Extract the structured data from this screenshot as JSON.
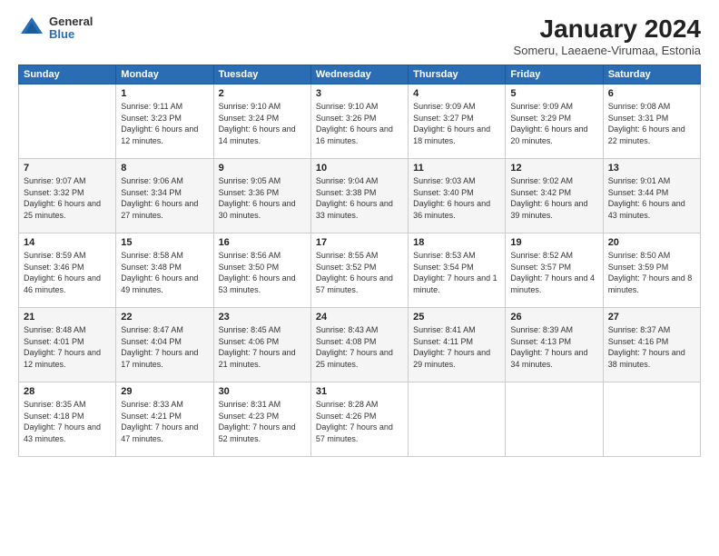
{
  "logo": {
    "general": "General",
    "blue": "Blue"
  },
  "header": {
    "title": "January 2024",
    "subtitle": "Someru, Laeaene-Virumaa, Estonia"
  },
  "weekdays": [
    "Sunday",
    "Monday",
    "Tuesday",
    "Wednesday",
    "Thursday",
    "Friday",
    "Saturday"
  ],
  "weeks": [
    [
      {
        "day": "",
        "sunrise": "",
        "sunset": "",
        "daylight": ""
      },
      {
        "day": "1",
        "sunrise": "Sunrise: 9:11 AM",
        "sunset": "Sunset: 3:23 PM",
        "daylight": "Daylight: 6 hours and 12 minutes."
      },
      {
        "day": "2",
        "sunrise": "Sunrise: 9:10 AM",
        "sunset": "Sunset: 3:24 PM",
        "daylight": "Daylight: 6 hours and 14 minutes."
      },
      {
        "day": "3",
        "sunrise": "Sunrise: 9:10 AM",
        "sunset": "Sunset: 3:26 PM",
        "daylight": "Daylight: 6 hours and 16 minutes."
      },
      {
        "day": "4",
        "sunrise": "Sunrise: 9:09 AM",
        "sunset": "Sunset: 3:27 PM",
        "daylight": "Daylight: 6 hours and 18 minutes."
      },
      {
        "day": "5",
        "sunrise": "Sunrise: 9:09 AM",
        "sunset": "Sunset: 3:29 PM",
        "daylight": "Daylight: 6 hours and 20 minutes."
      },
      {
        "day": "6",
        "sunrise": "Sunrise: 9:08 AM",
        "sunset": "Sunset: 3:31 PM",
        "daylight": "Daylight: 6 hours and 22 minutes."
      }
    ],
    [
      {
        "day": "7",
        "sunrise": "Sunrise: 9:07 AM",
        "sunset": "Sunset: 3:32 PM",
        "daylight": "Daylight: 6 hours and 25 minutes."
      },
      {
        "day": "8",
        "sunrise": "Sunrise: 9:06 AM",
        "sunset": "Sunset: 3:34 PM",
        "daylight": "Daylight: 6 hours and 27 minutes."
      },
      {
        "day": "9",
        "sunrise": "Sunrise: 9:05 AM",
        "sunset": "Sunset: 3:36 PM",
        "daylight": "Daylight: 6 hours and 30 minutes."
      },
      {
        "day": "10",
        "sunrise": "Sunrise: 9:04 AM",
        "sunset": "Sunset: 3:38 PM",
        "daylight": "Daylight: 6 hours and 33 minutes."
      },
      {
        "day": "11",
        "sunrise": "Sunrise: 9:03 AM",
        "sunset": "Sunset: 3:40 PM",
        "daylight": "Daylight: 6 hours and 36 minutes."
      },
      {
        "day": "12",
        "sunrise": "Sunrise: 9:02 AM",
        "sunset": "Sunset: 3:42 PM",
        "daylight": "Daylight: 6 hours and 39 minutes."
      },
      {
        "day": "13",
        "sunrise": "Sunrise: 9:01 AM",
        "sunset": "Sunset: 3:44 PM",
        "daylight": "Daylight: 6 hours and 43 minutes."
      }
    ],
    [
      {
        "day": "14",
        "sunrise": "Sunrise: 8:59 AM",
        "sunset": "Sunset: 3:46 PM",
        "daylight": "Daylight: 6 hours and 46 minutes."
      },
      {
        "day": "15",
        "sunrise": "Sunrise: 8:58 AM",
        "sunset": "Sunset: 3:48 PM",
        "daylight": "Daylight: 6 hours and 49 minutes."
      },
      {
        "day": "16",
        "sunrise": "Sunrise: 8:56 AM",
        "sunset": "Sunset: 3:50 PM",
        "daylight": "Daylight: 6 hours and 53 minutes."
      },
      {
        "day": "17",
        "sunrise": "Sunrise: 8:55 AM",
        "sunset": "Sunset: 3:52 PM",
        "daylight": "Daylight: 6 hours and 57 minutes."
      },
      {
        "day": "18",
        "sunrise": "Sunrise: 8:53 AM",
        "sunset": "Sunset: 3:54 PM",
        "daylight": "Daylight: 7 hours and 1 minute."
      },
      {
        "day": "19",
        "sunrise": "Sunrise: 8:52 AM",
        "sunset": "Sunset: 3:57 PM",
        "daylight": "Daylight: 7 hours and 4 minutes."
      },
      {
        "day": "20",
        "sunrise": "Sunrise: 8:50 AM",
        "sunset": "Sunset: 3:59 PM",
        "daylight": "Daylight: 7 hours and 8 minutes."
      }
    ],
    [
      {
        "day": "21",
        "sunrise": "Sunrise: 8:48 AM",
        "sunset": "Sunset: 4:01 PM",
        "daylight": "Daylight: 7 hours and 12 minutes."
      },
      {
        "day": "22",
        "sunrise": "Sunrise: 8:47 AM",
        "sunset": "Sunset: 4:04 PM",
        "daylight": "Daylight: 7 hours and 17 minutes."
      },
      {
        "day": "23",
        "sunrise": "Sunrise: 8:45 AM",
        "sunset": "Sunset: 4:06 PM",
        "daylight": "Daylight: 7 hours and 21 minutes."
      },
      {
        "day": "24",
        "sunrise": "Sunrise: 8:43 AM",
        "sunset": "Sunset: 4:08 PM",
        "daylight": "Daylight: 7 hours and 25 minutes."
      },
      {
        "day": "25",
        "sunrise": "Sunrise: 8:41 AM",
        "sunset": "Sunset: 4:11 PM",
        "daylight": "Daylight: 7 hours and 29 minutes."
      },
      {
        "day": "26",
        "sunrise": "Sunrise: 8:39 AM",
        "sunset": "Sunset: 4:13 PM",
        "daylight": "Daylight: 7 hours and 34 minutes."
      },
      {
        "day": "27",
        "sunrise": "Sunrise: 8:37 AM",
        "sunset": "Sunset: 4:16 PM",
        "daylight": "Daylight: 7 hours and 38 minutes."
      }
    ],
    [
      {
        "day": "28",
        "sunrise": "Sunrise: 8:35 AM",
        "sunset": "Sunset: 4:18 PM",
        "daylight": "Daylight: 7 hours and 43 minutes."
      },
      {
        "day": "29",
        "sunrise": "Sunrise: 8:33 AM",
        "sunset": "Sunset: 4:21 PM",
        "daylight": "Daylight: 7 hours and 47 minutes."
      },
      {
        "day": "30",
        "sunrise": "Sunrise: 8:31 AM",
        "sunset": "Sunset: 4:23 PM",
        "daylight": "Daylight: 7 hours and 52 minutes."
      },
      {
        "day": "31",
        "sunrise": "Sunrise: 8:28 AM",
        "sunset": "Sunset: 4:26 PM",
        "daylight": "Daylight: 7 hours and 57 minutes."
      },
      {
        "day": "",
        "sunrise": "",
        "sunset": "",
        "daylight": ""
      },
      {
        "day": "",
        "sunrise": "",
        "sunset": "",
        "daylight": ""
      },
      {
        "day": "",
        "sunrise": "",
        "sunset": "",
        "daylight": ""
      }
    ]
  ]
}
